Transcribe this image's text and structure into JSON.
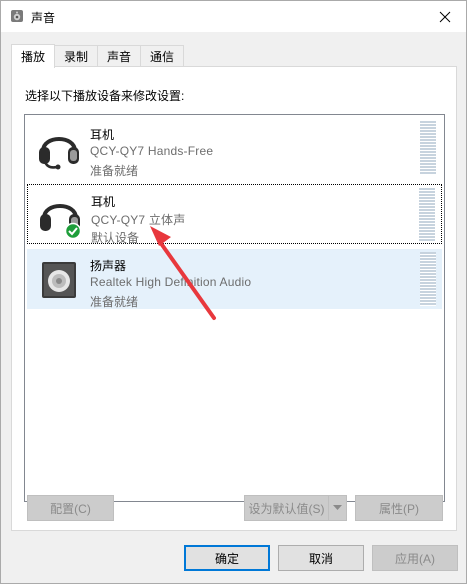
{
  "window": {
    "title": "声音"
  },
  "tabs": [
    {
      "label": "播放",
      "active": true
    },
    {
      "label": "录制",
      "active": false
    },
    {
      "label": "声音",
      "active": false
    },
    {
      "label": "通信",
      "active": false
    }
  ],
  "panel": {
    "instruction": "选择以下播放设备来修改设置:"
  },
  "devices": [
    {
      "icon": "headset-icon",
      "name": "耳机",
      "description": "QCY-QY7 Hands-Free",
      "status": "准备就绪",
      "default": false,
      "selected": false
    },
    {
      "icon": "headphones-icon",
      "name": "耳机",
      "description": "QCY-QY7 立体声",
      "status": "默认设备",
      "default": true,
      "selected": false,
      "focused": true
    },
    {
      "icon": "speaker-icon",
      "name": "扬声器",
      "description": "Realtek High Definition Audio",
      "status": "准备就绪",
      "default": false,
      "selected": true
    }
  ],
  "panel_buttons": {
    "configure": "配置(C)",
    "set_default": "设为默认值(S)",
    "properties": "属性(P)"
  },
  "footer_buttons": {
    "ok": "确定",
    "cancel": "取消",
    "apply": "应用(A)"
  },
  "colors": {
    "selection": "#e5f1fb",
    "primary_border": "#0078d7",
    "annotation_arrow": "#e8383d",
    "default_check": "#1e9e3a"
  }
}
